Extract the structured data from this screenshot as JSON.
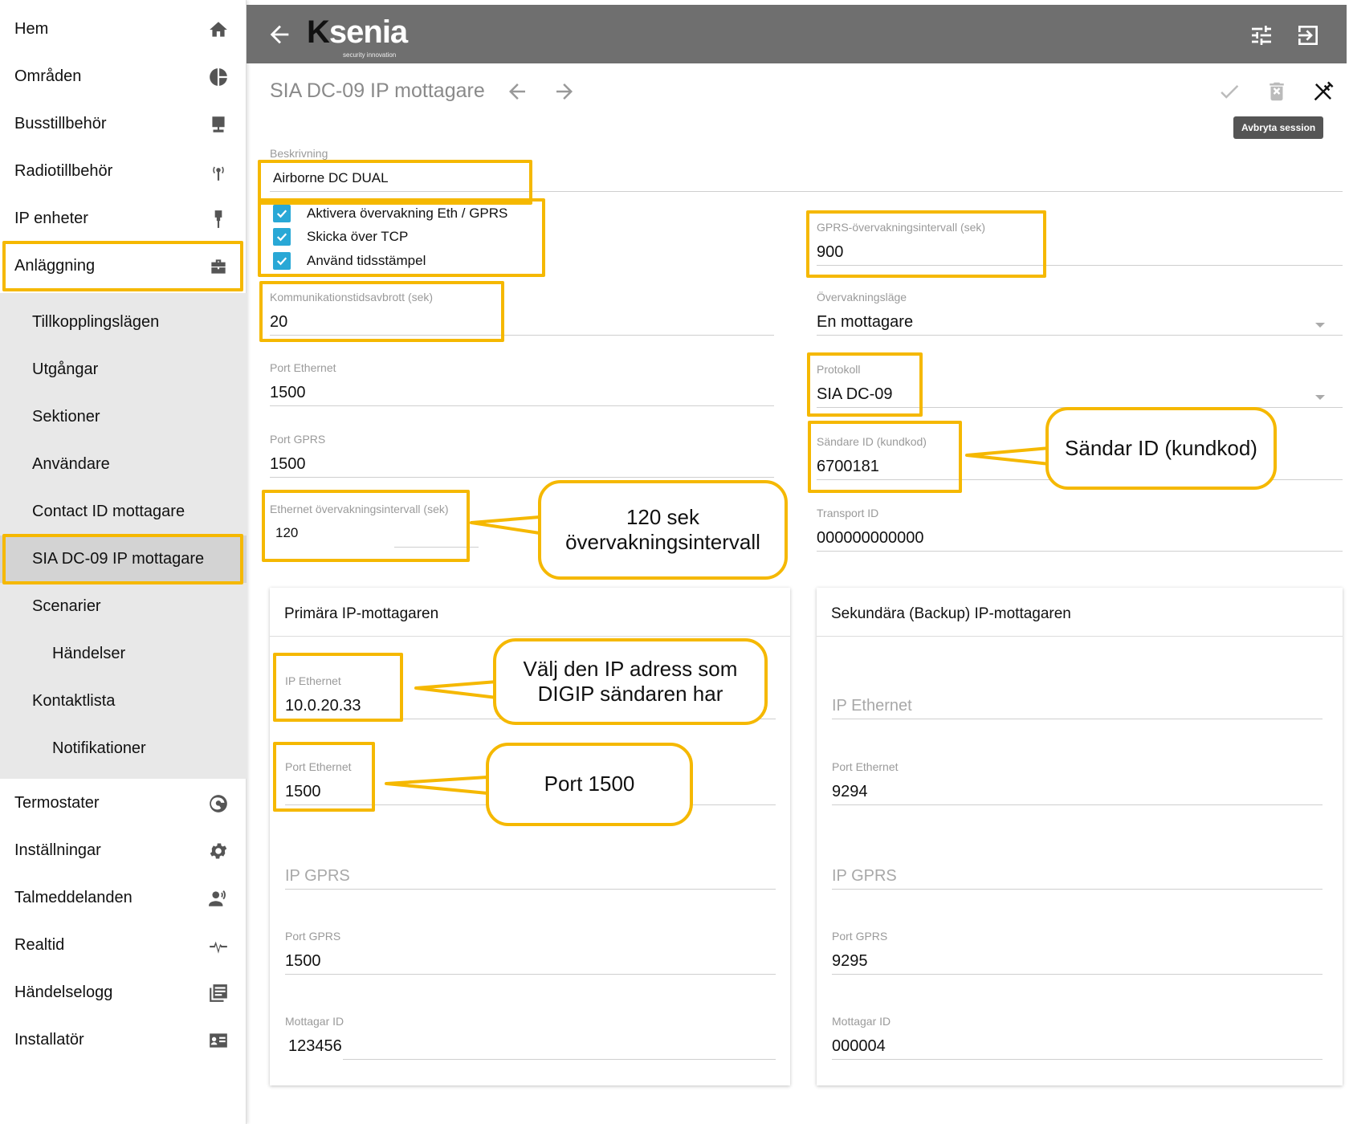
{
  "sidebar": {
    "items": [
      {
        "label": "Hem",
        "icon": "home-icon"
      },
      {
        "label": "Områden",
        "icon": "pie-chart-icon"
      },
      {
        "label": "Busstillbehör",
        "icon": "bus-device-icon"
      },
      {
        "label": "Radiotillbehör",
        "icon": "radio-icon"
      },
      {
        "label": "IP enheter",
        "icon": "ethernet-plug-icon"
      },
      {
        "label": "Anläggning",
        "icon": "briefcase-icon"
      }
    ],
    "subitems": [
      {
        "label": "Tillkopplingslägen"
      },
      {
        "label": "Utgångar"
      },
      {
        "label": "Sektioner"
      },
      {
        "label": "Användare"
      },
      {
        "label": "Contact ID mottagare"
      },
      {
        "label": "SIA DC-09 IP mottagare"
      },
      {
        "label": "Scenarier"
      },
      {
        "label": "Händelser"
      },
      {
        "label": "Kontaktlista"
      },
      {
        "label": "Notifikationer"
      }
    ],
    "bottom_items": [
      {
        "label": "Termostater",
        "icon": "thermostat-icon"
      },
      {
        "label": "Inställningar",
        "icon": "gear-icon"
      },
      {
        "label": "Talmeddelanden",
        "icon": "voice-icon"
      },
      {
        "label": "Realtid",
        "icon": "pulse-icon"
      },
      {
        "label": "Händelselogg",
        "icon": "log-icon"
      },
      {
        "label": "Installatör",
        "icon": "id-card-icon"
      }
    ]
  },
  "header": {
    "logo_k": "K",
    "logo_rest": "senia",
    "logo_sub": "security innovation"
  },
  "page": {
    "title": "SIA DC-09 IP mottagare",
    "tooltip": "Avbryta session"
  },
  "form": {
    "description_label": "Beskrivning",
    "description_value": "Airborne DC DUAL",
    "checkboxes": [
      "Aktivera övervakning Eth / GPRS",
      "Skicka över TCP",
      "Använd tidsstämpel"
    ],
    "comm_timeout_label": "Kommunikationstidsavbrott (sek)",
    "comm_timeout_value": "20",
    "port_eth_label": "Port Ethernet",
    "port_eth_value": "1500",
    "port_gprs_label": "Port GPRS",
    "port_gprs_value": "1500",
    "eth_interval_label": "Ethernet övervakningsintervall (sek)",
    "eth_interval_value": "120",
    "gprs_interval_label": "GPRS-övervakningsintervall (sek)",
    "gprs_interval_value": "900",
    "mode_label": "Övervakningsläge",
    "mode_value": "En mottagare",
    "protocol_label": "Protokoll",
    "protocol_value": "SIA DC-09",
    "sender_id_label": "Sändare ID (kundkod)",
    "sender_id_value": "6700181",
    "transport_label": "Transport ID",
    "transport_value": "000000000000"
  },
  "primary": {
    "title": "Primära IP-mottagaren",
    "ip_eth_label": "IP Ethernet",
    "ip_eth_value": "10.0.20.33",
    "port_eth_label": "Port Ethernet",
    "port_eth_value": "1500",
    "ip_gprs_placeholder": "IP GPRS",
    "port_gprs_label": "Port GPRS",
    "port_gprs_value": "1500",
    "receiver_label": "Mottagar ID",
    "receiver_value": "123456"
  },
  "secondary": {
    "title": "Sekundära (Backup) IP-mottagaren",
    "ip_eth_placeholder": "IP Ethernet",
    "port_eth_label": "Port Ethernet",
    "port_eth_value": "9294",
    "ip_gprs_placeholder": "IP GPRS",
    "port_gprs_label": "Port GPRS",
    "port_gprs_value": "9295",
    "receiver_label": "Mottagar ID",
    "receiver_value": "000004"
  },
  "callouts": {
    "sender": "Sändar ID (kundkod)",
    "interval_line1": "120 sek",
    "interval_line2": "övervakningsintervall",
    "ip_line1": "Välj den IP adress som",
    "ip_line2": "DIGIP sändaren har",
    "port": "Port 1500"
  },
  "colors": {
    "highlight": "#f5b800",
    "header": "#6f6f6f",
    "checkbox": "#29a8d6"
  }
}
